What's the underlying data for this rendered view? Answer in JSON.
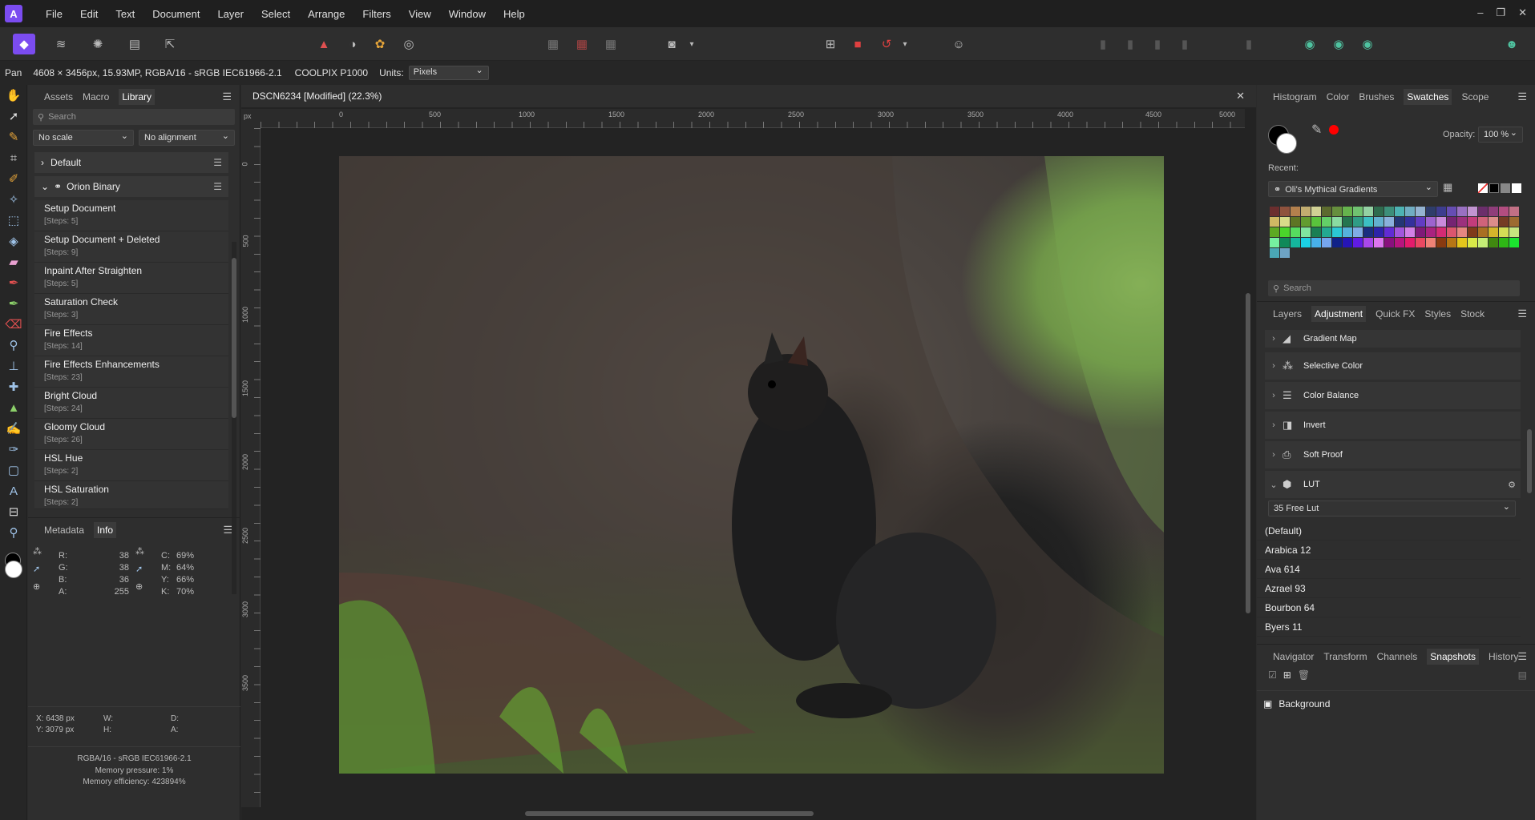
{
  "menubar": {
    "items": [
      "File",
      "Edit",
      "Text",
      "Document",
      "Layer",
      "Select",
      "Arrange",
      "Filters",
      "View",
      "Window",
      "Help"
    ],
    "window_controls": [
      "–",
      "❐",
      "✕"
    ]
  },
  "contextbar": {
    "tool": "Pan",
    "image_info": "4608 × 3456px, 15.93MP, RGBA/16 - sRGB IEC61966-2.1",
    "camera": "COOLPIX P1000",
    "units_label": "Units:",
    "units_value": "Pixels"
  },
  "left": {
    "tabs": [
      "Assets",
      "Macro",
      "Library"
    ],
    "search_placeholder": "Search",
    "scale": "No scale",
    "alignment": "No alignment",
    "categories": [
      "Default",
      "Orion Binary"
    ],
    "macros": [
      {
        "name": "Setup Document",
        "steps": "[Steps: 5]"
      },
      {
        "name": "Setup Document + Deleted",
        "steps": "[Steps: 9]"
      },
      {
        "name": "Inpaint After Straighten",
        "steps": "[Steps: 5]"
      },
      {
        "name": "Saturation Check",
        "steps": "[Steps: 3]"
      },
      {
        "name": "Fire Effects",
        "steps": "[Steps: 14]"
      },
      {
        "name": "Fire Effects Enhancements",
        "steps": "[Steps: 23]"
      },
      {
        "name": "Bright Cloud",
        "steps": "[Steps: 24]"
      },
      {
        "name": "Gloomy Cloud",
        "steps": "[Steps: 26]"
      },
      {
        "name": "HSL Hue",
        "steps": "[Steps: 2]"
      },
      {
        "name": "HSL Saturation",
        "steps": "[Steps: 2]"
      }
    ],
    "info_tabs": [
      "Metadata",
      "Info"
    ],
    "rgb": {
      "r_label": "R:",
      "r": "38",
      "g_label": "G:",
      "g": "38",
      "b_label": "B:",
      "b": "36",
      "a_label": "A:",
      "a": "255"
    },
    "cmyk": {
      "c_label": "C:",
      "c": "69%",
      "m_label": "M:",
      "m": "64%",
      "y_label": "Y:",
      "y": "66%",
      "k_label": "K:",
      "k": "70%"
    },
    "pos": {
      "x": "X: 6438 px",
      "y": "Y: 3079 px",
      "w": "W:",
      "h": "H:",
      "d": "D:",
      "a": "A:"
    },
    "footer": {
      "profile": "RGBA/16 - sRGB IEC61966-2.1",
      "pressure": "Memory pressure: 1%",
      "efficiency": "Memory efficiency: 423894%"
    }
  },
  "canvas": {
    "doc_title": "DSCN6234 [Modified] (22.3%)",
    "ruler_unit": "px",
    "ruler_top": [
      "0",
      "500",
      "1000",
      "1500",
      "2000",
      "2500",
      "3000",
      "3500",
      "4000",
      "4500",
      "5000"
    ],
    "ruler_left": [
      "0",
      "500",
      "1000",
      "1500",
      "2000",
      "2500",
      "3000",
      "3500"
    ]
  },
  "right": {
    "top_tabs": [
      "Histogram",
      "Color",
      "Brushes",
      "Swatches",
      "Scope"
    ],
    "opacity_label": "Opacity:",
    "opacity": "100 %",
    "recent_label": "Recent:",
    "palette": "Oli's Mythical Gradients",
    "search_placeholder": "Search",
    "mid_tabs": [
      "Layers",
      "Adjustment",
      "Quick FX",
      "Styles",
      "Stock"
    ],
    "adjustments": [
      "Gradient Map",
      "Selective Color",
      "Color Balance",
      "Invert",
      "Soft Proof",
      "LUT"
    ],
    "lut_preset": "35 Free Lut",
    "luts": [
      "(Default)",
      "Arabica 12",
      "Ava 614",
      "Azrael 93",
      "Bourbon 64",
      "Byers 11"
    ],
    "bottom_tabs": [
      "Navigator",
      "Transform",
      "Channels",
      "Snapshots",
      "History"
    ],
    "snapshot": "Background"
  },
  "colors": {
    "accent": "#7b4cf0",
    "primary_fill": "#000000",
    "secondary_fill": "#ffffff",
    "recent_red": "#ff0000"
  }
}
